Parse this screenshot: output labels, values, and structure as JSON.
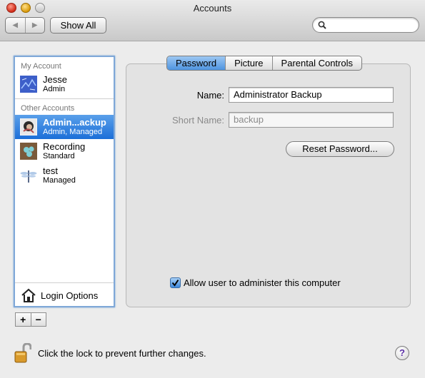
{
  "window": {
    "title": "Accounts"
  },
  "toolbar": {
    "show_all_label": "Show All",
    "search_value": ""
  },
  "sidebar": {
    "my_account_label": "My Account",
    "other_accounts_label": "Other Accounts",
    "accounts": [
      {
        "name": "Jesse",
        "role": "Admin"
      },
      {
        "name": "Admin...ackup",
        "role": "Admin, Managed"
      },
      {
        "name": "Recording",
        "role": "Standard"
      },
      {
        "name": "test",
        "role": "Managed"
      }
    ],
    "login_options_label": "Login Options",
    "add_label": "+",
    "remove_label": "−"
  },
  "tabs": [
    "Password",
    "Picture",
    "Parental Controls"
  ],
  "form": {
    "name_label": "Name:",
    "name_value": "Administrator Backup",
    "short_name_label": "Short Name:",
    "short_name_value": "backup",
    "reset_password_label": "Reset Password...",
    "allow_admin_label": "Allow user to administer this computer"
  },
  "footer": {
    "lock_text": "Click the lock to prevent further changes.",
    "help_label": "?"
  },
  "colors": {
    "selection": "#1c6fd8",
    "focus_ring": "#7fa8d8"
  }
}
